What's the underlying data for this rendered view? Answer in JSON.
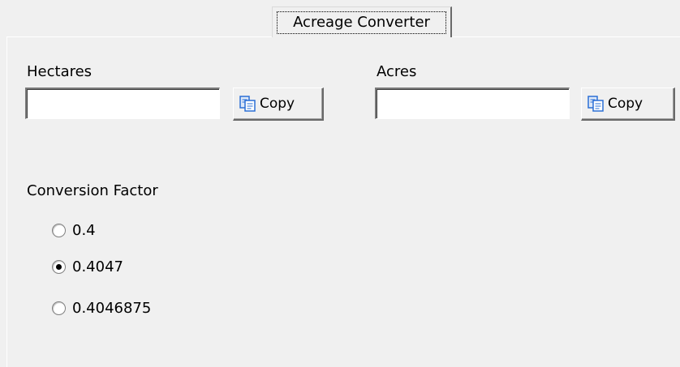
{
  "tab": {
    "label": "Acreage Converter"
  },
  "hectares": {
    "label": "Hectares",
    "value": "",
    "copy_label": "Copy",
    "copy_icon": "copy-icon"
  },
  "acres": {
    "label": "Acres",
    "value": "",
    "copy_label": "Copy",
    "copy_icon": "copy-icon"
  },
  "conversion": {
    "label": "Conversion Factor",
    "options": [
      {
        "label": "0.4",
        "selected": false
      },
      {
        "label": "0.4047",
        "selected": true
      },
      {
        "label": "0.4046875",
        "selected": false
      }
    ]
  },
  "colors": {
    "background": "#f0f0f0",
    "input_background": "#ffffff",
    "icon_blue": "#2a6fd6"
  }
}
